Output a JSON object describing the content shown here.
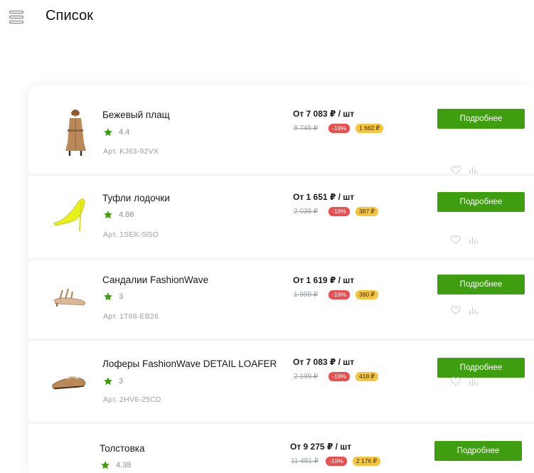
{
  "header": {
    "title": "Список"
  },
  "products": [
    {
      "name": "Бежевый плащ",
      "rating": "4.4",
      "sku": "Арт. KJ63-92VX",
      "price": "От 7 083 ₽ / шт",
      "old_price": "8 745 ₽",
      "discount": "-19%",
      "saving": "1 662 ₽",
      "button": "Подробнее"
    },
    {
      "name": "Туфли лодочки",
      "rating": "4.86",
      "sku": "Арт. 1SEK-5I5O",
      "price": "От 1 651 ₽ / шт",
      "old_price": "2 038 ₽",
      "discount": "-19%",
      "saving": "387 ₽",
      "button": "Подробнее"
    },
    {
      "name": "Сандалии FashionWave",
      "rating": "3",
      "sku": "Арт. 1T68-EB26",
      "price": "От 1 619 ₽ / шт",
      "old_price": "1 999 ₽",
      "discount": "-19%",
      "saving": "380 ₽",
      "button": "Подробнее"
    },
    {
      "name": "Лоферы FashionWave DETAIL LOAFER",
      "rating": "3",
      "sku": "Арт. 2HV6-25CD",
      "price": "От 7 083 ₽ / шт",
      "old_price": "2 199 ₽",
      "discount": "-19%",
      "saving": "418 ₽",
      "button": "Подробнее"
    },
    {
      "name": "Толстовка",
      "rating": "4.38",
      "sku": "",
      "price": "От 9 275 ₽ / шт",
      "old_price": "11 451 ₽",
      "discount": "-19%",
      "saving": "2 176 ₽",
      "button": "Подробнее"
    }
  ],
  "icons": {
    "menu": "menu-icon",
    "star": "star-icon",
    "favorite": "heart-icon",
    "compare": "bar-chart-icon"
  },
  "colors": {
    "accent": "#3f9e10",
    "discount": "#e8504f",
    "saving": "#f5c542",
    "star": "#3f9e10"
  }
}
